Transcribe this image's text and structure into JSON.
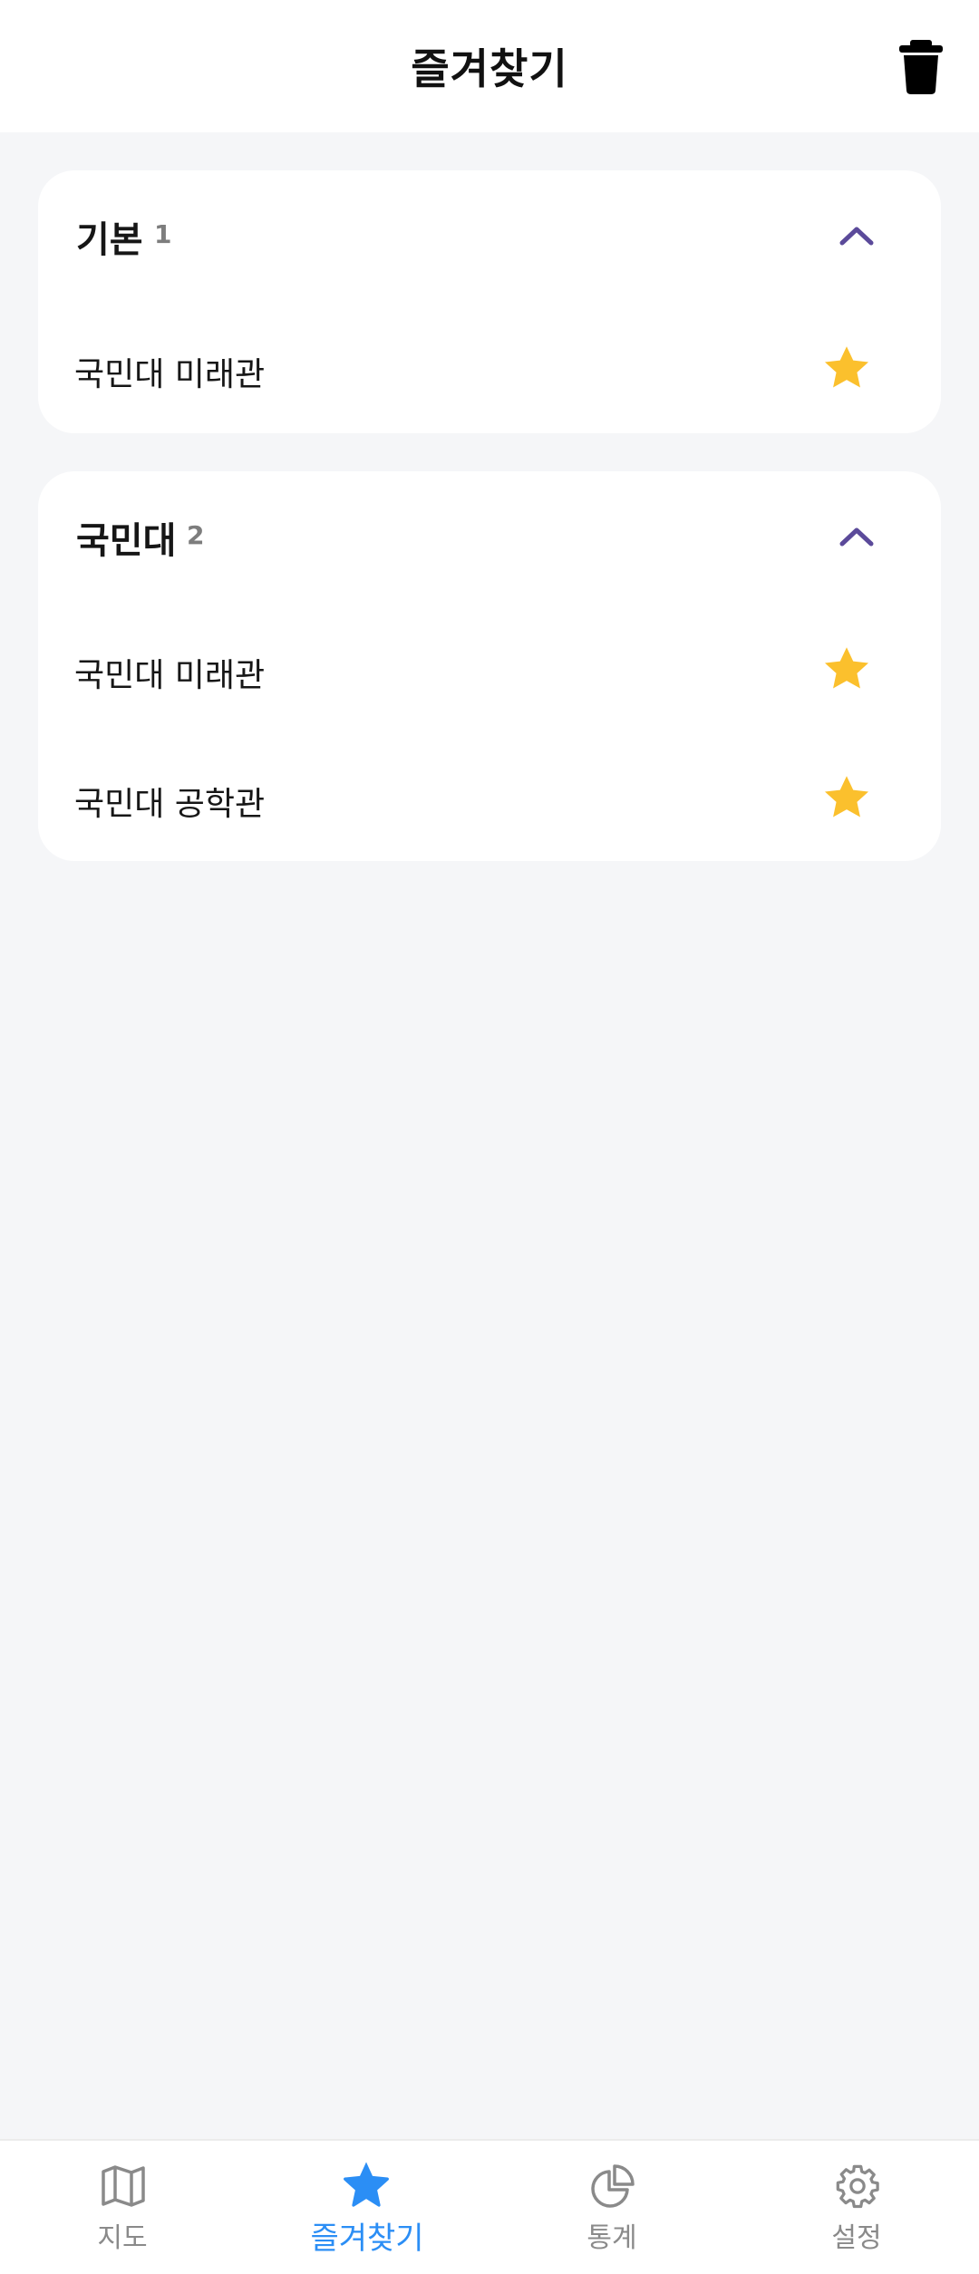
{
  "header": {
    "title": "즐겨찾기",
    "trash_icon": "trash-icon"
  },
  "groups": [
    {
      "name": "기본",
      "count": "1",
      "items": [
        {
          "label": "국민대 미래관",
          "favorite": true
        }
      ]
    },
    {
      "name": "국민대",
      "count": "2",
      "items": [
        {
          "label": "국민대 미래관",
          "favorite": true
        },
        {
          "label": "국민대 공학관",
          "favorite": true
        }
      ]
    }
  ],
  "tabs": [
    {
      "label": "지도",
      "icon": "map-icon",
      "active": false
    },
    {
      "label": "즐겨찾기",
      "icon": "star-icon",
      "active": true
    },
    {
      "label": "통계",
      "icon": "pie-chart-icon",
      "active": false
    },
    {
      "label": "설정",
      "icon": "gear-icon",
      "active": false
    }
  ],
  "colors": {
    "accent": "#2b8ef5",
    "star": "#fbc02d",
    "chevron": "#5b4a9a",
    "background": "#f5f6f8"
  }
}
